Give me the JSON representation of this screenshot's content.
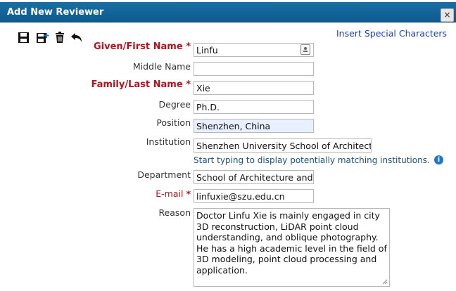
{
  "dialog": {
    "title": "Add New Reviewer",
    "close_glyph": "×"
  },
  "toolbar": {
    "special_chars": "Insert Special Characters"
  },
  "fields": {
    "given_label": "Given/First Name",
    "given_value": "Linfu",
    "middle_label": "Middle Name",
    "middle_value": "",
    "family_label": "Family/Last Name",
    "family_value": "Xie",
    "degree_label": "Degree",
    "degree_value": "Ph.D.",
    "position_label": "Position",
    "position_value": "Shenzhen, China",
    "institution_label": "Institution",
    "institution_value": "Shenzhen University School of Architect",
    "institution_hint": "Start typing to display potentially matching institutions.",
    "department_label": "Department",
    "department_value": "School of Architecture and",
    "email_label": "E-mail",
    "email_value": "linfuxie@szu.edu.cn",
    "reason_label": "Reason",
    "reason_value": "Doctor Linfu Xie is mainly engaged in city 3D reconstruction, LiDAR point cloud understanding, and oblique photography. He has a high academic level in the field of 3D modeling, point cloud processing and application.",
    "required_mark": "*",
    "info_glyph": "i"
  }
}
